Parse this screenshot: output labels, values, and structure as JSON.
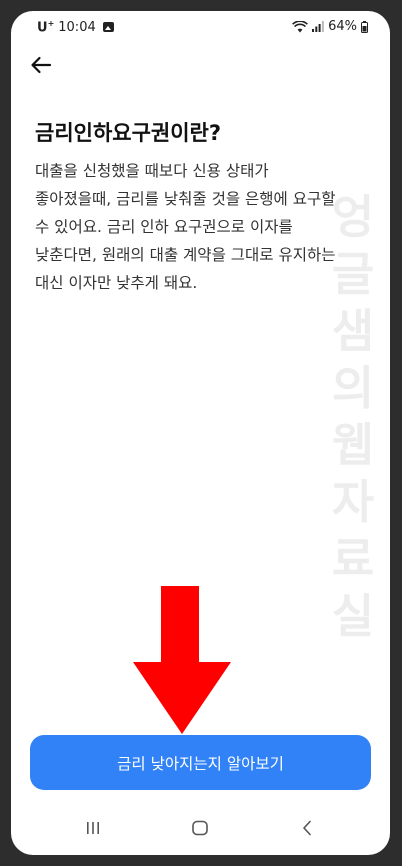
{
  "status_bar": {
    "carrier": "U",
    "carrier_mark": "+",
    "time": "10:04",
    "battery": "64%"
  },
  "page": {
    "title": "금리인하요구권이란?",
    "body": "대출을 신청했을 때보다 신용 상태가\n좋아졌을때, 금리를 낮춰줄 것을 은행에 요구할\n수 있어요. 금리 인하 요구권으로 이자를\n낮춘다면, 원래의 대출 계약을 그대로 유지하는\n대신 이자만 낮추게 돼요."
  },
  "watermark": "엉글샘의웹자료실",
  "cta_button": {
    "label": "금리 낮아지는지 알아보기"
  },
  "colors": {
    "accent": "#3182f6",
    "annotation_arrow": "#ff0000"
  },
  "icons": {
    "back": "arrow-left-icon",
    "nav_recents": "recents-icon",
    "nav_home": "home-icon",
    "nav_back": "chevron-left-icon"
  }
}
